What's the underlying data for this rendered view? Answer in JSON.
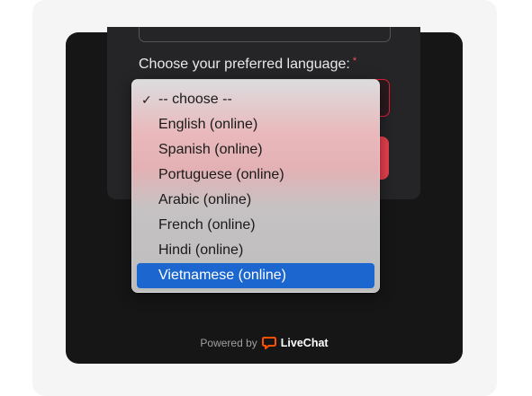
{
  "form": {
    "language_label": "Choose your preferred language:",
    "required_marker": "*"
  },
  "dropdown": {
    "checked_index": 0,
    "checkmark": "✓",
    "highlighted_index": 7,
    "options": [
      {
        "label": "-- choose --"
      },
      {
        "label": "English (online)"
      },
      {
        "label": "Spanish (online)"
      },
      {
        "label": "Portuguese (online)"
      },
      {
        "label": "Arabic (online)"
      },
      {
        "label": "French (online)"
      },
      {
        "label": "Hindi (online)"
      },
      {
        "label": "Vietnamese (online)"
      }
    ]
  },
  "footer": {
    "powered_by": "Powered by",
    "brand": "LiveChat"
  },
  "colors": {
    "accent_red": "#e7404e",
    "required_red": "#ff4d5e",
    "highlight_blue": "#1b66cf",
    "brand_orange": "#ff5100",
    "widget_bg": "#161616"
  },
  "icons": {
    "brand_logo": "livechat-logo-icon",
    "check": "checkmark-icon"
  }
}
